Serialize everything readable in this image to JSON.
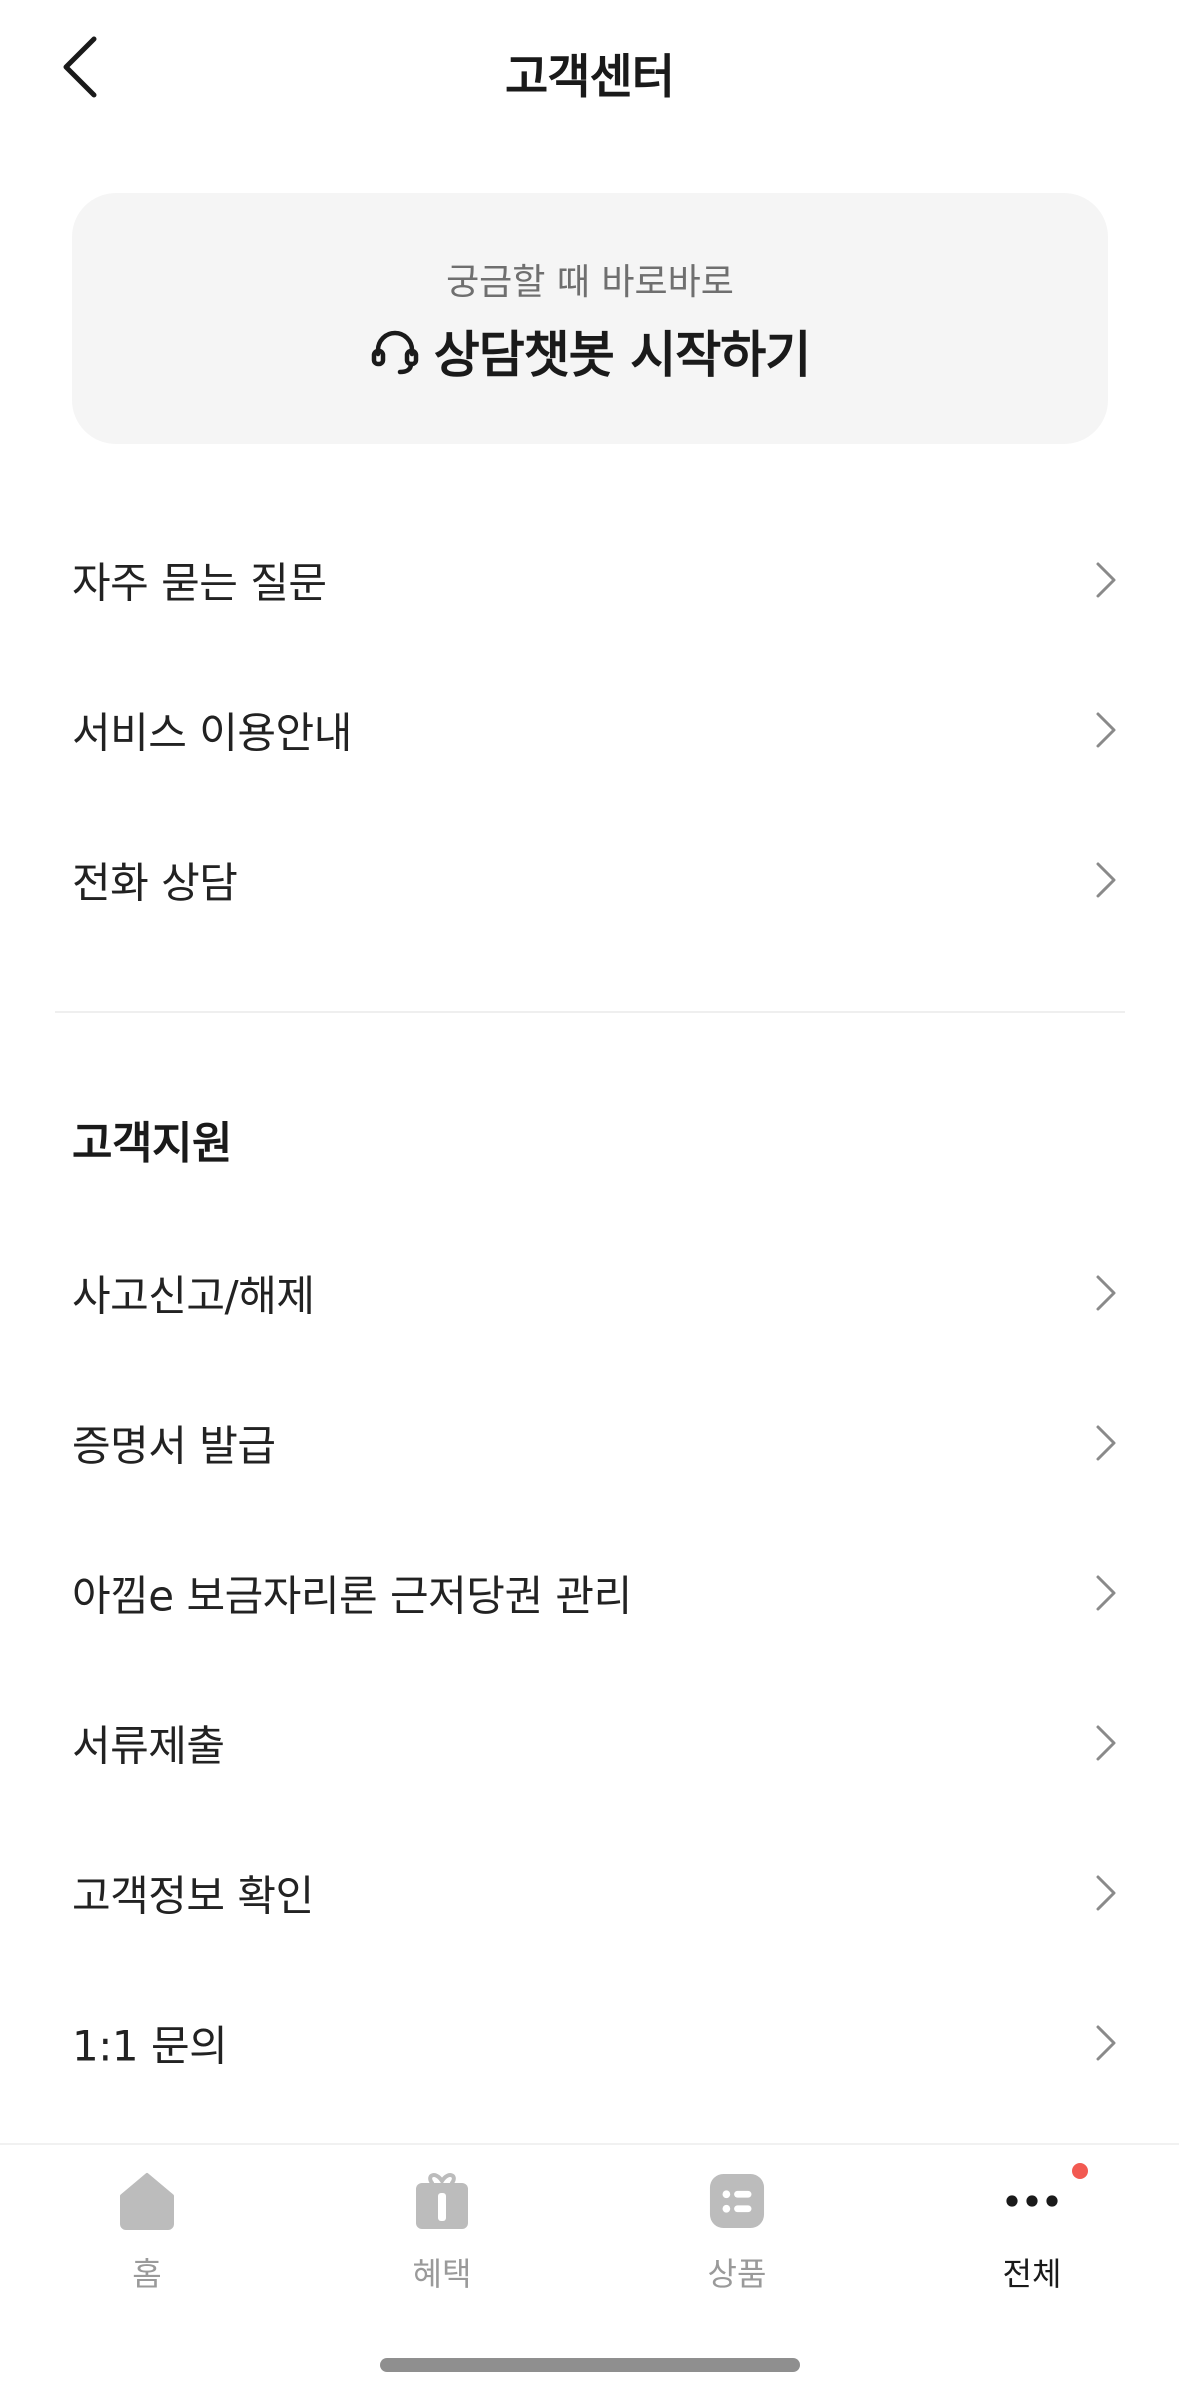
{
  "header": {
    "title": "고객센터",
    "back_icon": "chevron-left-icon"
  },
  "chatbot": {
    "subtitle": "궁금할 때 바로바로",
    "label": "상담챗봇 시작하기",
    "icon": "headset-icon"
  },
  "menu": [
    {
      "label": "자주 묻는 질문"
    },
    {
      "label": "서비스 이용안내"
    },
    {
      "label": "전화 상담"
    }
  ],
  "support": {
    "title": "고객지원",
    "items": [
      {
        "label": "사고신고/해제"
      },
      {
        "label": "증명서 발급"
      },
      {
        "label": "아낌e 보금자리론 근저당권 관리"
      },
      {
        "label": "서류제출"
      },
      {
        "label": "고객정보 확인"
      },
      {
        "label": "1:1 문의"
      }
    ]
  },
  "tabbar": {
    "tabs": [
      {
        "label": "홈",
        "icon": "home-icon",
        "active": false
      },
      {
        "label": "혜택",
        "icon": "gift-icon",
        "active": false
      },
      {
        "label": "상품",
        "icon": "list-icon",
        "active": false
      },
      {
        "label": "전체",
        "icon": "more-icon",
        "active": true,
        "badge": true
      }
    ]
  },
  "colors": {
    "accent_dot": "#f25a52",
    "card_bg": "#f5f5f5",
    "inactive_tab": "#9a9a9a"
  }
}
